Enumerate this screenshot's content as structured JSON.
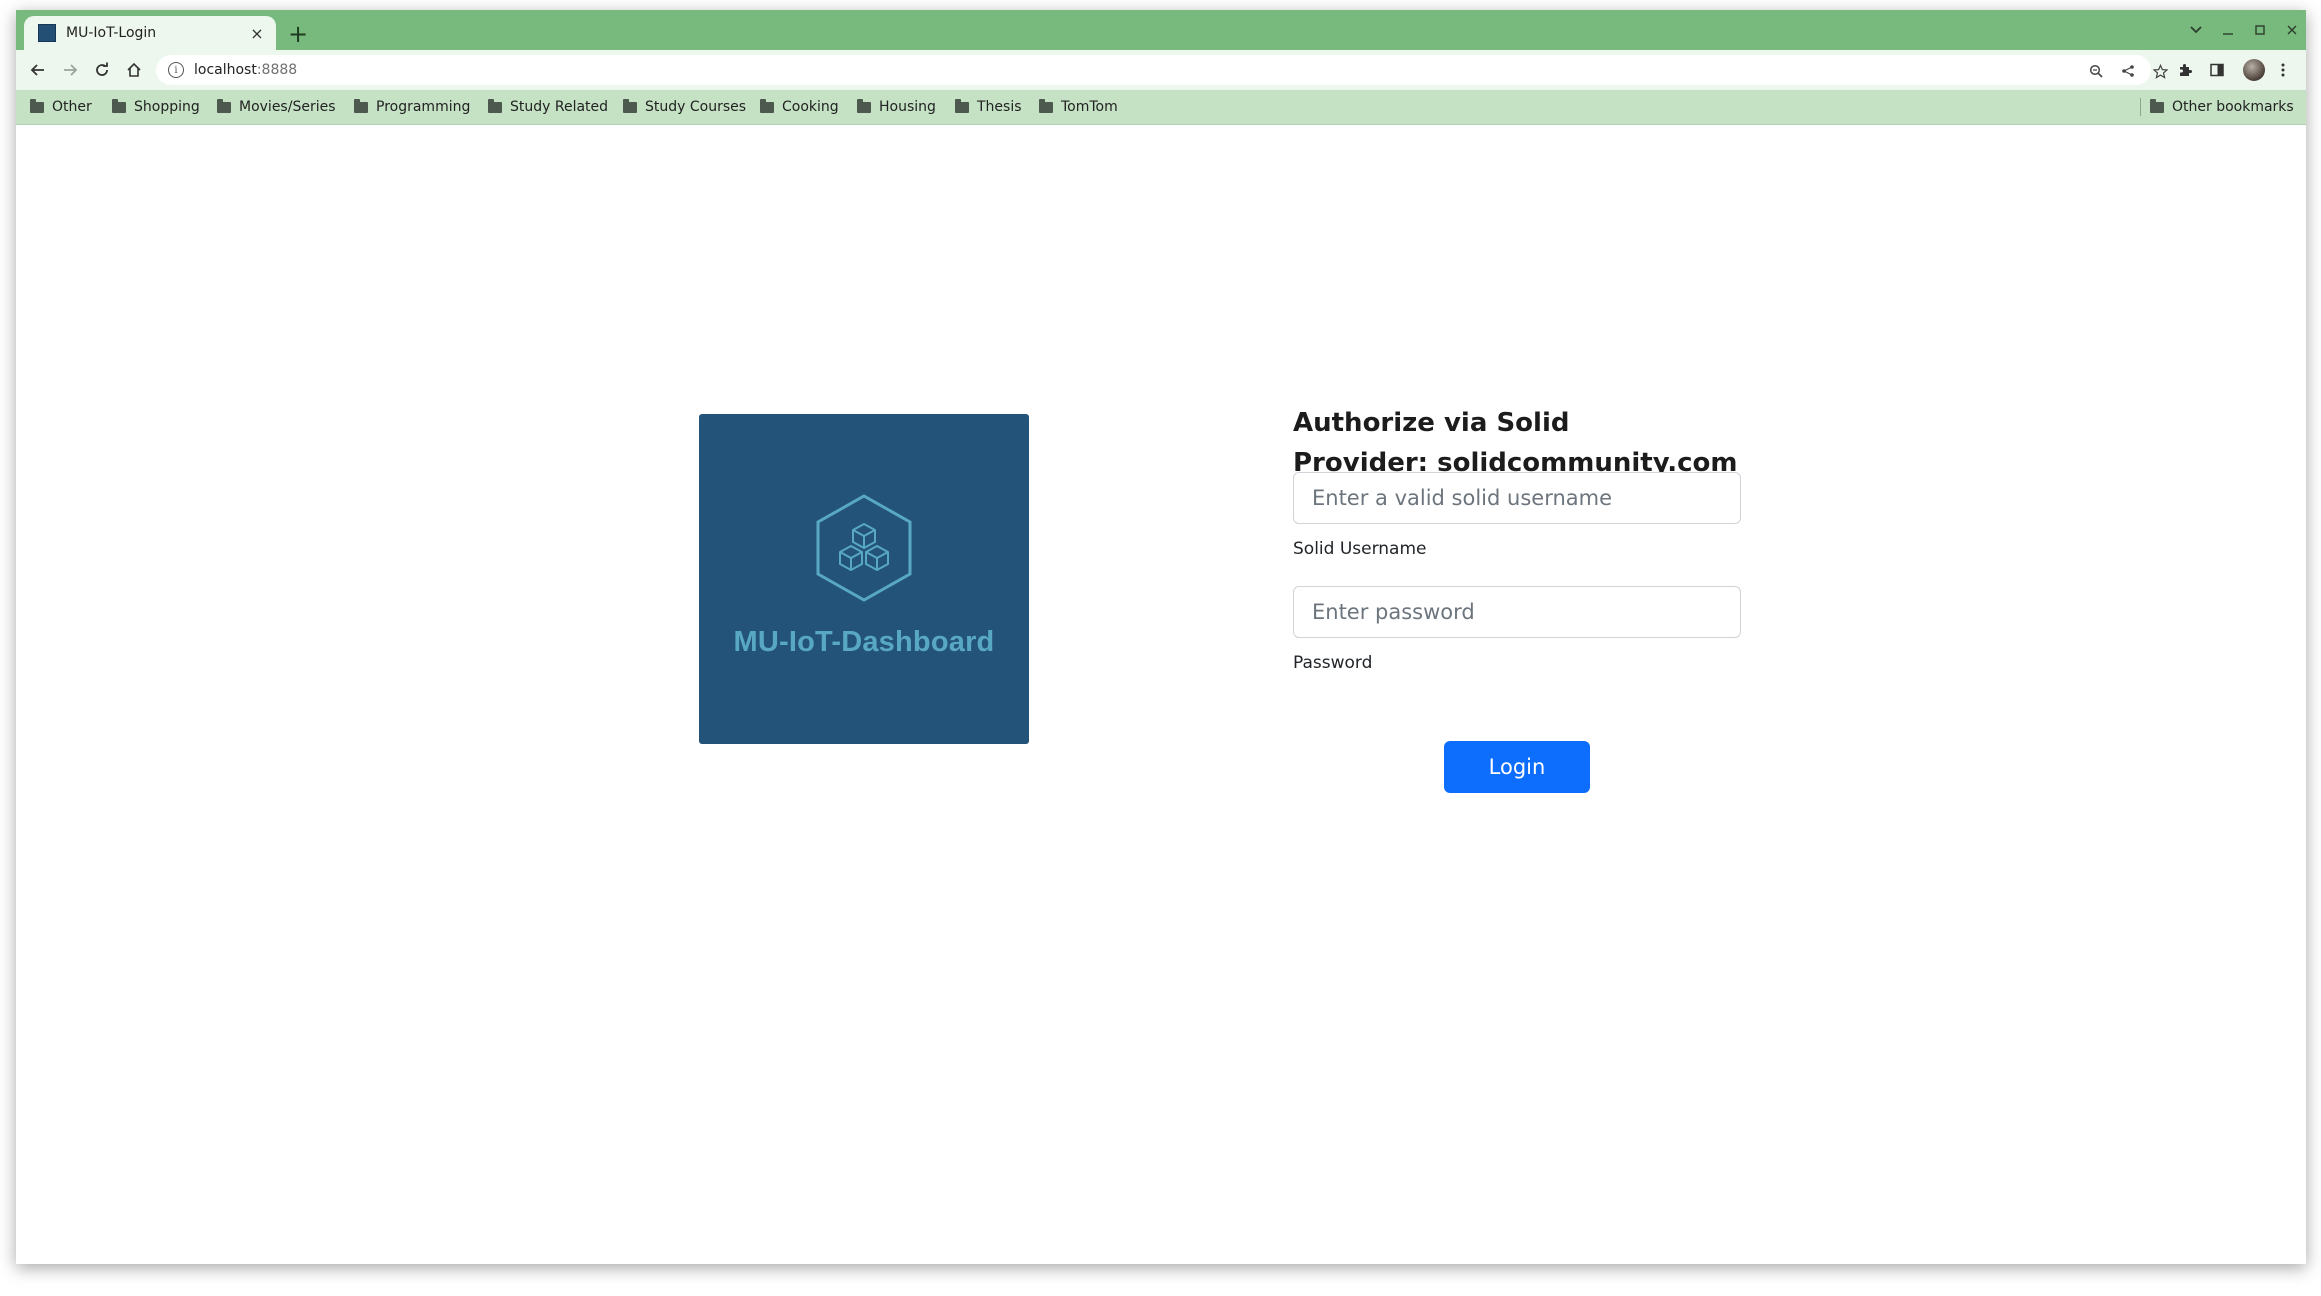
{
  "browser": {
    "tab_title": "MU-IoT-Login",
    "tab_close": "×",
    "new_tab": "+",
    "url_host": "localhost",
    "url_port": ":8888",
    "window_controls": {
      "dropdown": "⌄",
      "minimize": "–",
      "maximize": "□",
      "close": "×"
    }
  },
  "bookmarks": [
    "Other",
    "Shopping",
    "Movies/Series",
    "Programming",
    "Study Related",
    "Study Courses",
    "Cooking",
    "Housing",
    "Thesis",
    "TomTom"
  ],
  "other_bookmarks": "Other bookmarks",
  "logo": {
    "title": "MU-IoT-Dashboard",
    "background_color": "#235379",
    "accent_color": "#58a8c3"
  },
  "auth": {
    "heading_line1": "Authorize via Solid",
    "heading_line2": "Provider: solidcommunity.com",
    "username_placeholder": "Enter a valid solid username",
    "username_label": "Solid Username",
    "password_placeholder": "Enter password",
    "password_label": "Password",
    "login_label": "Login",
    "button_color": "#0d6efd"
  },
  "theme": {
    "tabstrip_color": "#78ba7d",
    "toolbar_color": "#eef7ee",
    "bookmarks_bar_color": "#c5e2c5"
  }
}
